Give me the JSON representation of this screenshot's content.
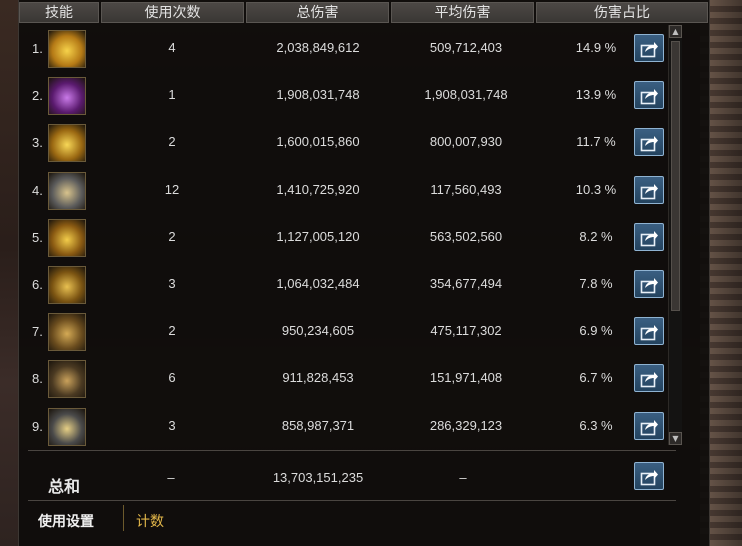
{
  "headers": {
    "skill": "技能",
    "uses": "使用次数",
    "total_damage": "总伤害",
    "avg_damage": "平均伤害",
    "damage_share": "伤害占比"
  },
  "rows": [
    {
      "index": "1.",
      "icon": "flame-burst-skill-icon",
      "uses": "4",
      "total": "2,038,849,612",
      "avg": "509,712,403",
      "share": "14.9 %"
    },
    {
      "index": "2.",
      "icon": "purple-lightning-skill-icon",
      "uses": "1",
      "total": "1,908,031,748",
      "avg": "1,908,031,748",
      "share": "13.9 %"
    },
    {
      "index": "3.",
      "icon": "radiant-slash-skill-icon",
      "uses": "2",
      "total": "1,600,015,860",
      "avg": "800,007,930",
      "share": "11.7 %"
    },
    {
      "index": "4.",
      "icon": "club-strike-skill-icon",
      "uses": "12",
      "total": "1,410,725,920",
      "avg": "117,560,493",
      "share": "10.3 %"
    },
    {
      "index": "5.",
      "icon": "star-explosion-skill-icon",
      "uses": "2",
      "total": "1,127,005,120",
      "avg": "563,502,560",
      "share": "8.2 %"
    },
    {
      "index": "6.",
      "icon": "spear-thrust-skill-icon",
      "uses": "3",
      "total": "1,064,032,484",
      "avg": "354,677,494",
      "share": "7.8 %"
    },
    {
      "index": "7.",
      "icon": "cog-shot-skill-icon",
      "uses": "2",
      "total": "950,234,605",
      "avg": "475,117,302",
      "share": "6.9 %"
    },
    {
      "index": "8.",
      "icon": "star-medallion-skill-icon",
      "uses": "6",
      "total": "911,828,453",
      "avg": "151,971,408",
      "share": "6.7 %"
    },
    {
      "index": "9.",
      "icon": "triple-arrow-skill-icon",
      "uses": "3",
      "total": "858,987,371",
      "avg": "286,329,123",
      "share": "6.3 %"
    }
  ],
  "summary": {
    "label": "总和",
    "uses": "–",
    "total": "13,703,151,235",
    "avg": "–"
  },
  "footer": {
    "settings_tab": "使用设置",
    "count_tab": "计数"
  },
  "colors": {
    "accent_gold": "#e4b84a",
    "share_button": "#2f5373"
  }
}
